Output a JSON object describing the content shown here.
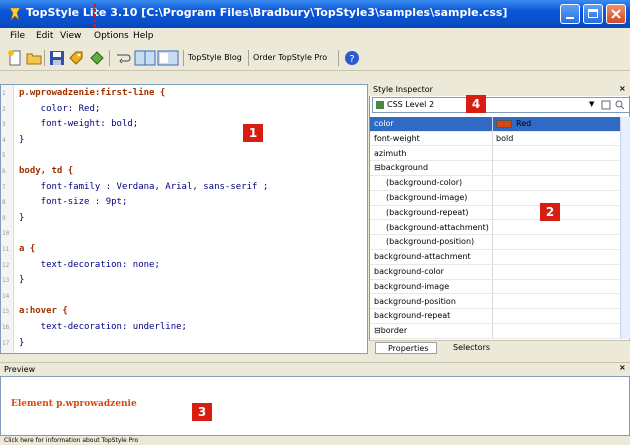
{
  "window": {
    "title": "TopStyle Lite 3.10 [C:\\Program Files\\Bradbury\\TopStyle3\\samples\\sample.css]"
  },
  "menu": [
    "File",
    "Edit",
    "View",
    "Options",
    "Help"
  ],
  "toolbar": {
    "blog_label": "TopStyle Blog",
    "order_label": "Order TopStyle Pro"
  },
  "editor": {
    "line_numbers": [
      "1",
      "2",
      "3",
      "4",
      "5",
      "6",
      "7",
      "8",
      "9",
      "10",
      "11",
      "12",
      "13",
      "14",
      "15",
      "16",
      "17"
    ],
    "lines": [
      {
        "text": "p.wprowadzenie:first-line {",
        "kind": "sel"
      },
      {
        "text": "    color: Red;",
        "kind": "prop"
      },
      {
        "text": "    font-weight: bold;",
        "kind": "prop"
      },
      {
        "text": "}",
        "kind": "brace"
      },
      {
        "text": "",
        "kind": "prop"
      },
      {
        "text": "body, td {",
        "kind": "sel"
      },
      {
        "text": "    font-family : Verdana, Arial, sans-serif ;",
        "kind": "prop"
      },
      {
        "text": "    font-size : 9pt;",
        "kind": "prop"
      },
      {
        "text": "}",
        "kind": "brace"
      },
      {
        "text": "",
        "kind": "prop"
      },
      {
        "text": "a {",
        "kind": "sel"
      },
      {
        "text": "    text-decoration: none;",
        "kind": "prop"
      },
      {
        "text": "}",
        "kind": "brace"
      },
      {
        "text": "",
        "kind": "prop"
      },
      {
        "text": "a:hover {",
        "kind": "sel"
      },
      {
        "text": "    text-decoration: underline;",
        "kind": "prop"
      },
      {
        "text": "}",
        "kind": "brace"
      }
    ]
  },
  "inspector": {
    "header": "Style Inspector",
    "level": "CSS Level 2",
    "properties": [
      {
        "name": "color",
        "value": "Red",
        "selected": true,
        "swatch": "#d84810"
      },
      {
        "name": "font-weight",
        "value": "bold"
      },
      {
        "name": "azimuth",
        "value": ""
      },
      {
        "name": "⊟background",
        "value": "",
        "group": true
      },
      {
        "name": "(background-color)",
        "value": "",
        "indent": true
      },
      {
        "name": "(background-image)",
        "value": "",
        "indent": true
      },
      {
        "name": "(background-repeat)",
        "value": "",
        "indent": true
      },
      {
        "name": "(background-attachment)",
        "value": "",
        "indent": true
      },
      {
        "name": "(background-position)",
        "value": "",
        "indent": true
      },
      {
        "name": "background-attachment",
        "value": ""
      },
      {
        "name": "background-color",
        "value": ""
      },
      {
        "name": "background-image",
        "value": ""
      },
      {
        "name": "background-position",
        "value": ""
      },
      {
        "name": "background-repeat",
        "value": ""
      },
      {
        "name": "⊟border",
        "value": "",
        "group": true
      }
    ],
    "tabs": [
      "Properties",
      "Selectors"
    ]
  },
  "preview": {
    "header": "Preview",
    "sample_text": "Element p.wprowadzenie"
  },
  "status": {
    "text": "Click here for information about TopStyle Pro"
  },
  "callouts": [
    "1",
    "2",
    "3",
    "4"
  ],
  "colors": {
    "accent_red": "#d81e10",
    "selected_row": "#316ac5",
    "titlebar": "#0a55d8"
  }
}
